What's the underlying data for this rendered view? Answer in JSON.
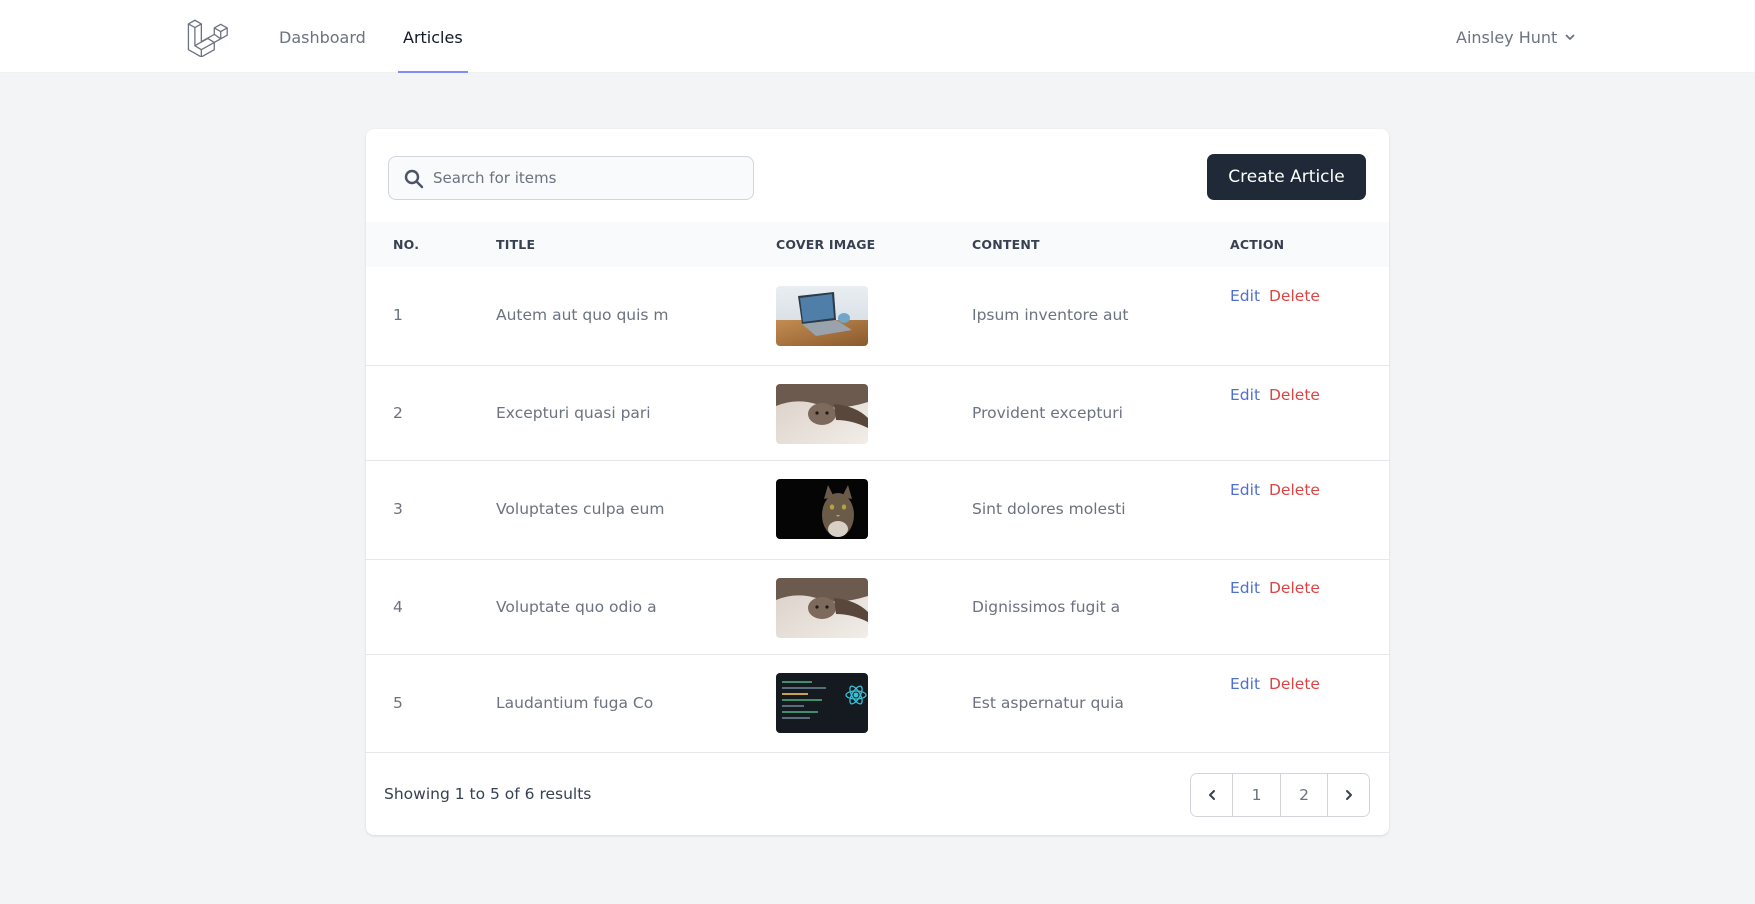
{
  "nav": {
    "links": [
      {
        "label": "Dashboard"
      },
      {
        "label": "Articles"
      }
    ],
    "user_name": "Ainsley Hunt"
  },
  "search": {
    "placeholder": "Search for items",
    "value": ""
  },
  "create_button": "Create Article",
  "table": {
    "headers": [
      "NO.",
      "TITLE",
      "COVER IMAGE",
      "CONTENT",
      "ACTION"
    ],
    "rows": [
      {
        "no": "1",
        "title": "Autem aut quo quis m",
        "image": "laptop-image",
        "content": "Ipsum inventore aut",
        "edit": "Edit",
        "delete": "Delete"
      },
      {
        "no": "2",
        "title": "Excepturi quasi pari",
        "image": "kitten-blanket-image",
        "content": "Provident excepturi",
        "edit": "Edit",
        "delete": "Delete"
      },
      {
        "no": "3",
        "title": "Voluptates culpa eum",
        "image": "cat-dark-image",
        "content": "Sint dolores molesti",
        "edit": "Edit",
        "delete": "Delete"
      },
      {
        "no": "4",
        "title": "Voluptate quo odio a",
        "image": "kitten-blanket-image",
        "content": "Dignissimos fugit a",
        "edit": "Edit",
        "delete": "Delete"
      },
      {
        "no": "5",
        "title": "Laudantium fuga Co",
        "image": "react-code-image",
        "content": "Est aspernatur quia",
        "edit": "Edit",
        "delete": "Delete"
      }
    ]
  },
  "pagination": {
    "summary": "Showing 1 to 5 of 6 results",
    "pages": [
      "1",
      "2"
    ]
  },
  "colors": {
    "accent": "#818cf8",
    "edit": "#4f6fd1",
    "delete": "#dc4545",
    "button": "#1f2937"
  }
}
